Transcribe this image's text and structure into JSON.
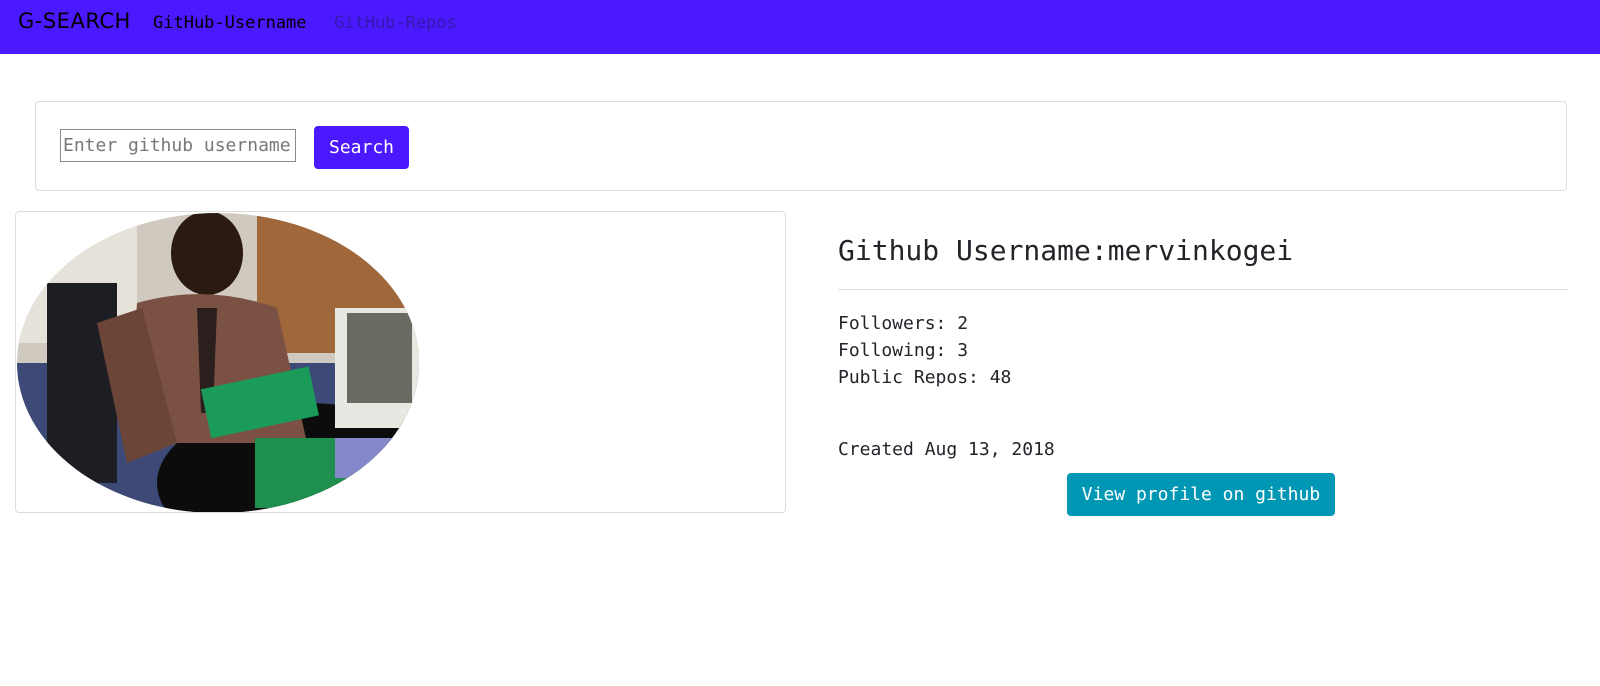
{
  "navbar": {
    "brand": "G-SEARCH",
    "links": [
      {
        "label": "GitHub-Username"
      },
      {
        "label": "GitHub-Repos"
      }
    ],
    "background": "#4b19ff"
  },
  "search": {
    "placeholder": "Enter github username",
    "value": "",
    "button_label": "Search"
  },
  "profile": {
    "avatar_icon": "user-photo",
    "username_line": "Github Username:mervinkogei",
    "followers": "Followers: 2",
    "following": "Following: 3",
    "public_repos": "Public Repos: 48",
    "created": "Created Aug 13, 2018",
    "view_button_label": "View profile on github",
    "view_button_color": "#0097b5"
  }
}
